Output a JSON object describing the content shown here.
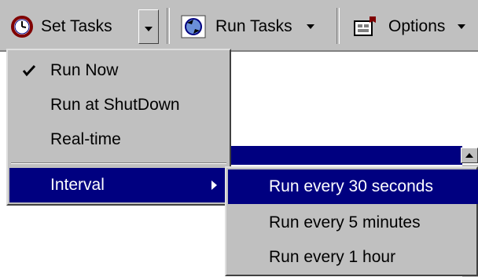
{
  "toolbar": {
    "set_tasks_label": "Set Tasks",
    "run_tasks_label": "Run Tasks",
    "options_label": "Options"
  },
  "menu": {
    "items": [
      {
        "label": "Run Now",
        "checked": true
      },
      {
        "label": "Run at ShutDown"
      },
      {
        "label": "Real-time"
      },
      {
        "label": "Interval",
        "has_submenu": true,
        "highlighted": true
      }
    ]
  },
  "submenu": {
    "items": [
      {
        "label": "Run every 30 seconds",
        "highlighted": true
      },
      {
        "label": "Run every 5 minutes"
      },
      {
        "label": "Run every 1 hour"
      }
    ]
  },
  "colors": {
    "highlight": "#000080",
    "face": "#c0c0c0"
  }
}
